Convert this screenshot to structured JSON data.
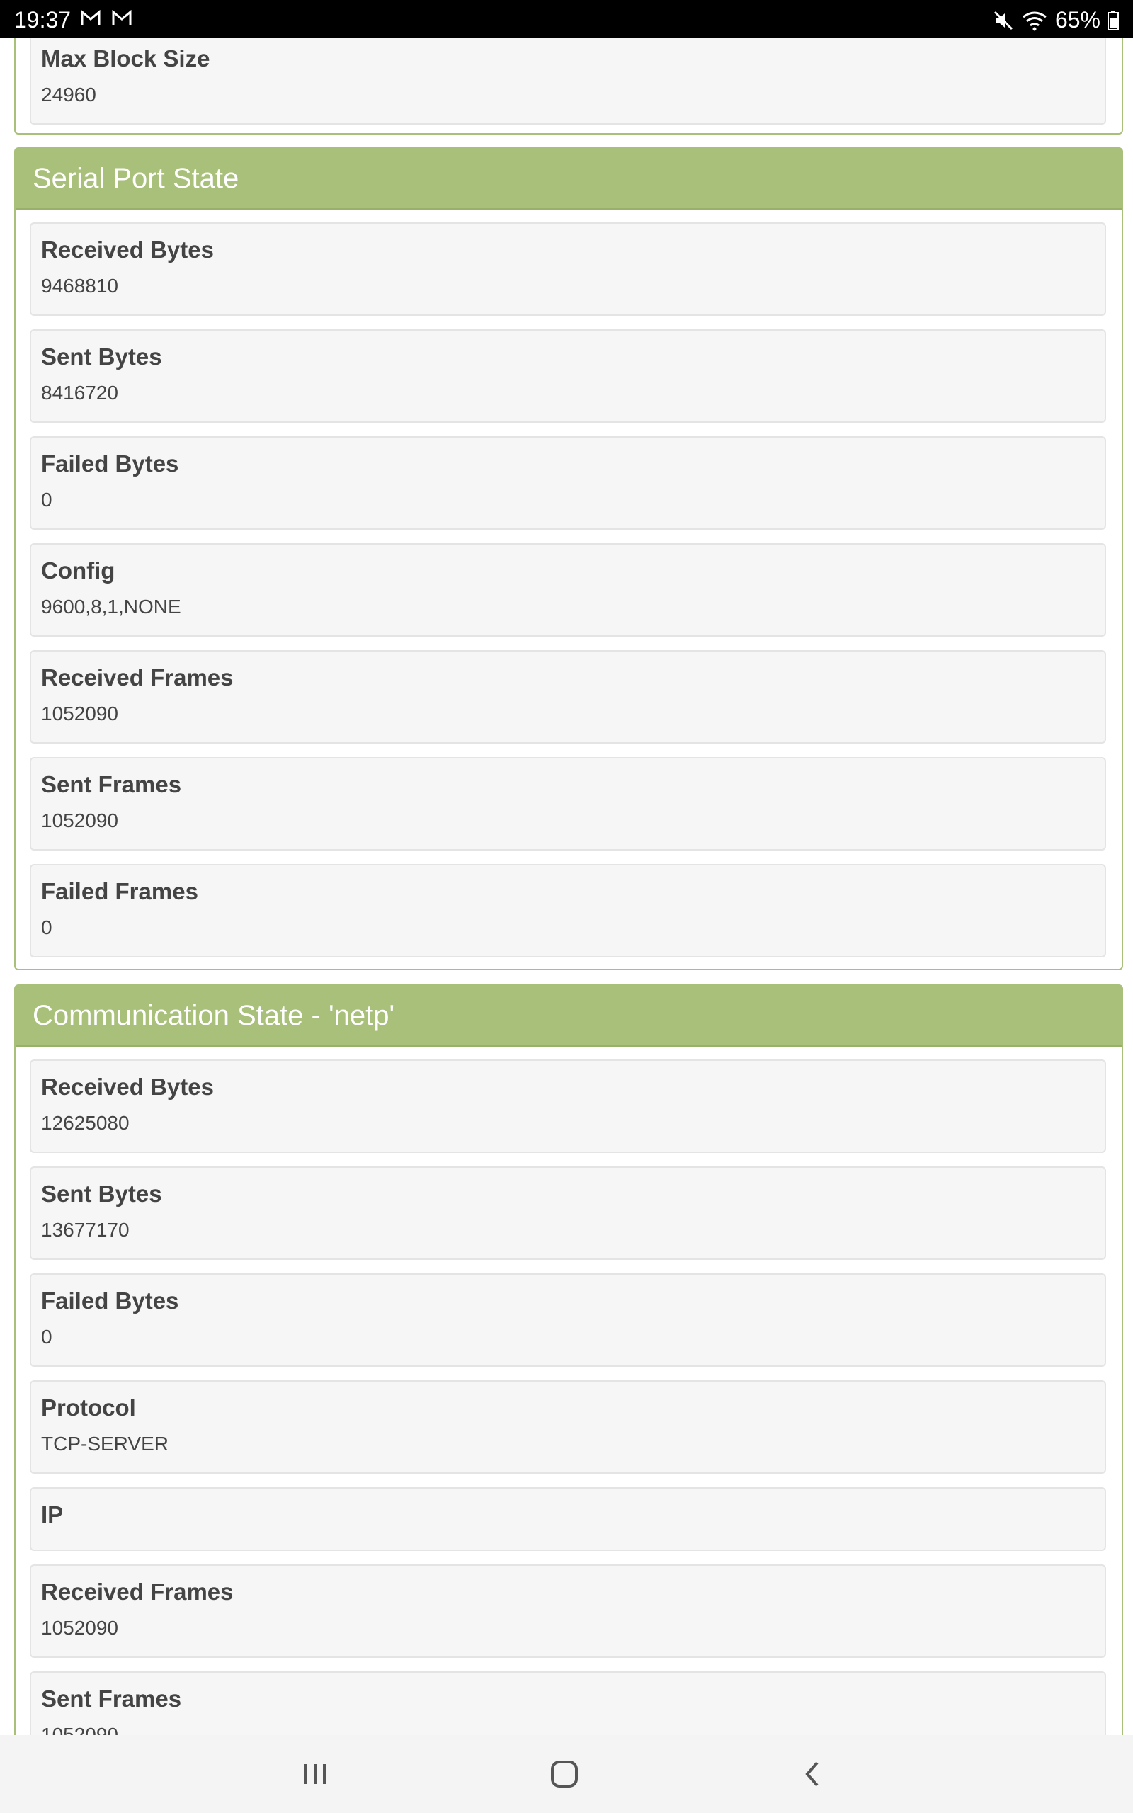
{
  "status_bar": {
    "time": "19:37",
    "battery": "65%",
    "icons": [
      "gmail-icon",
      "gmail-icon",
      "mute-icon",
      "wifi-icon",
      "battery-icon"
    ]
  },
  "top_partial": {
    "label": "Max Block Size",
    "value": "24960"
  },
  "serial_panel": {
    "title": "Serial Port State",
    "rows": [
      {
        "label": "Received Bytes",
        "value": "9468810"
      },
      {
        "label": "Sent Bytes",
        "value": "8416720"
      },
      {
        "label": "Failed Bytes",
        "value": "0"
      },
      {
        "label": "Config",
        "value": "9600,8,1,NONE"
      },
      {
        "label": "Received Frames",
        "value": "1052090"
      },
      {
        "label": "Sent Frames",
        "value": "1052090"
      },
      {
        "label": "Failed Frames",
        "value": "0"
      }
    ]
  },
  "comm_panel": {
    "title": "Communication State - 'netp'",
    "rows": [
      {
        "label": "Received Bytes",
        "value": "12625080"
      },
      {
        "label": "Sent Bytes",
        "value": "13677170"
      },
      {
        "label": "Failed Bytes",
        "value": "0"
      },
      {
        "label": "Protocol",
        "value": "TCP-SERVER"
      },
      {
        "label": "IP",
        "value": ""
      },
      {
        "label": "Received Frames",
        "value": "1052090"
      },
      {
        "label": "Sent Frames",
        "value": "1052090"
      }
    ]
  },
  "nav_bar": {
    "icons": [
      "recent-apps-icon",
      "home-icon",
      "back-icon"
    ]
  }
}
